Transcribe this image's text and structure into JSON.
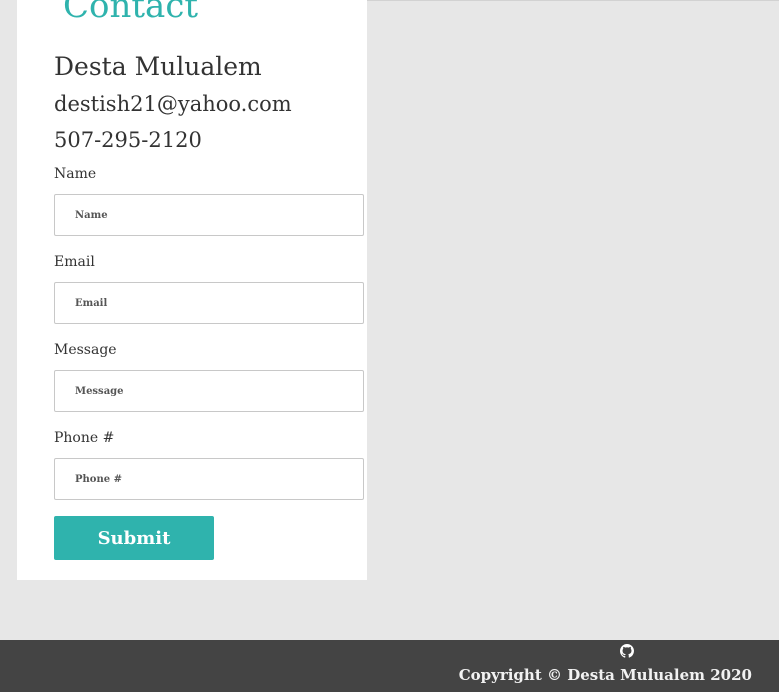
{
  "contact": {
    "title": "Contact",
    "person_name": "Desta Mulualem",
    "email": "destish21@yahoo.com",
    "phone": "507-295-2120"
  },
  "form": {
    "fields": [
      {
        "label": "Name",
        "placeholder": "Name"
      },
      {
        "label": "Email",
        "placeholder": "Email"
      },
      {
        "label": "Message",
        "placeholder": "Message"
      },
      {
        "label": "Phone #",
        "placeholder": "Phone #"
      }
    ],
    "submit_label": "Submit"
  },
  "footer": {
    "icon": "github-icon",
    "copyright": "Copyright © Desta Mulualem 2020"
  },
  "colors": {
    "accent": "#2fb3ad",
    "footer_bg": "#444444",
    "page_bg": "#e7e7e7"
  }
}
